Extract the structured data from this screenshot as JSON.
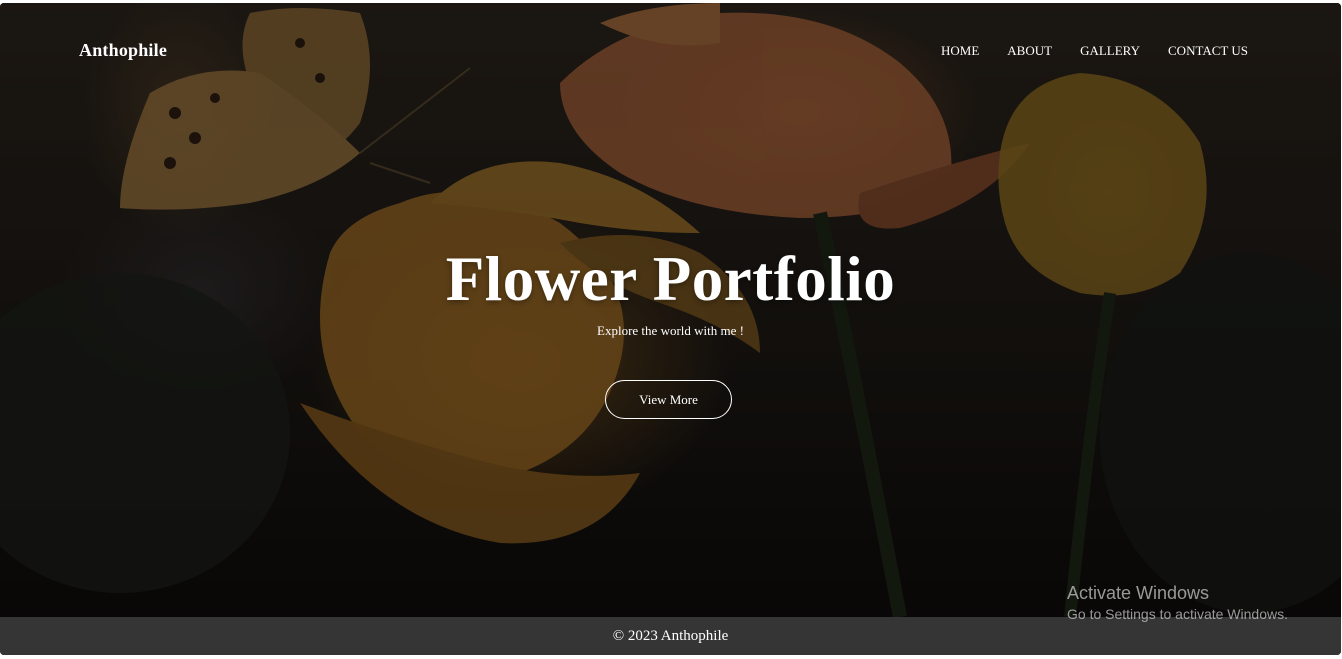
{
  "brand": {
    "name": "Anthophile"
  },
  "nav": {
    "items": [
      "HOME",
      "ABOUT",
      "GALLERY",
      "CONTACT US"
    ]
  },
  "hero": {
    "title": "Flower Portfolio",
    "subtitle": "Explore the world with me !",
    "button_label": "View More",
    "image_description_icons": [
      "butterfly-icon",
      "flower-icon"
    ]
  },
  "footer": {
    "copyright": "© 2023 Anthophile"
  },
  "watermark": {
    "title": "Activate Windows",
    "subtitle": "Go to Settings to activate Windows."
  },
  "colors": {
    "overlay": "#000000",
    "footer_bg": "#353535",
    "text": "#ffffff",
    "petal_orange": "#c98a3d",
    "petal_yellow": "#d9a43a"
  }
}
